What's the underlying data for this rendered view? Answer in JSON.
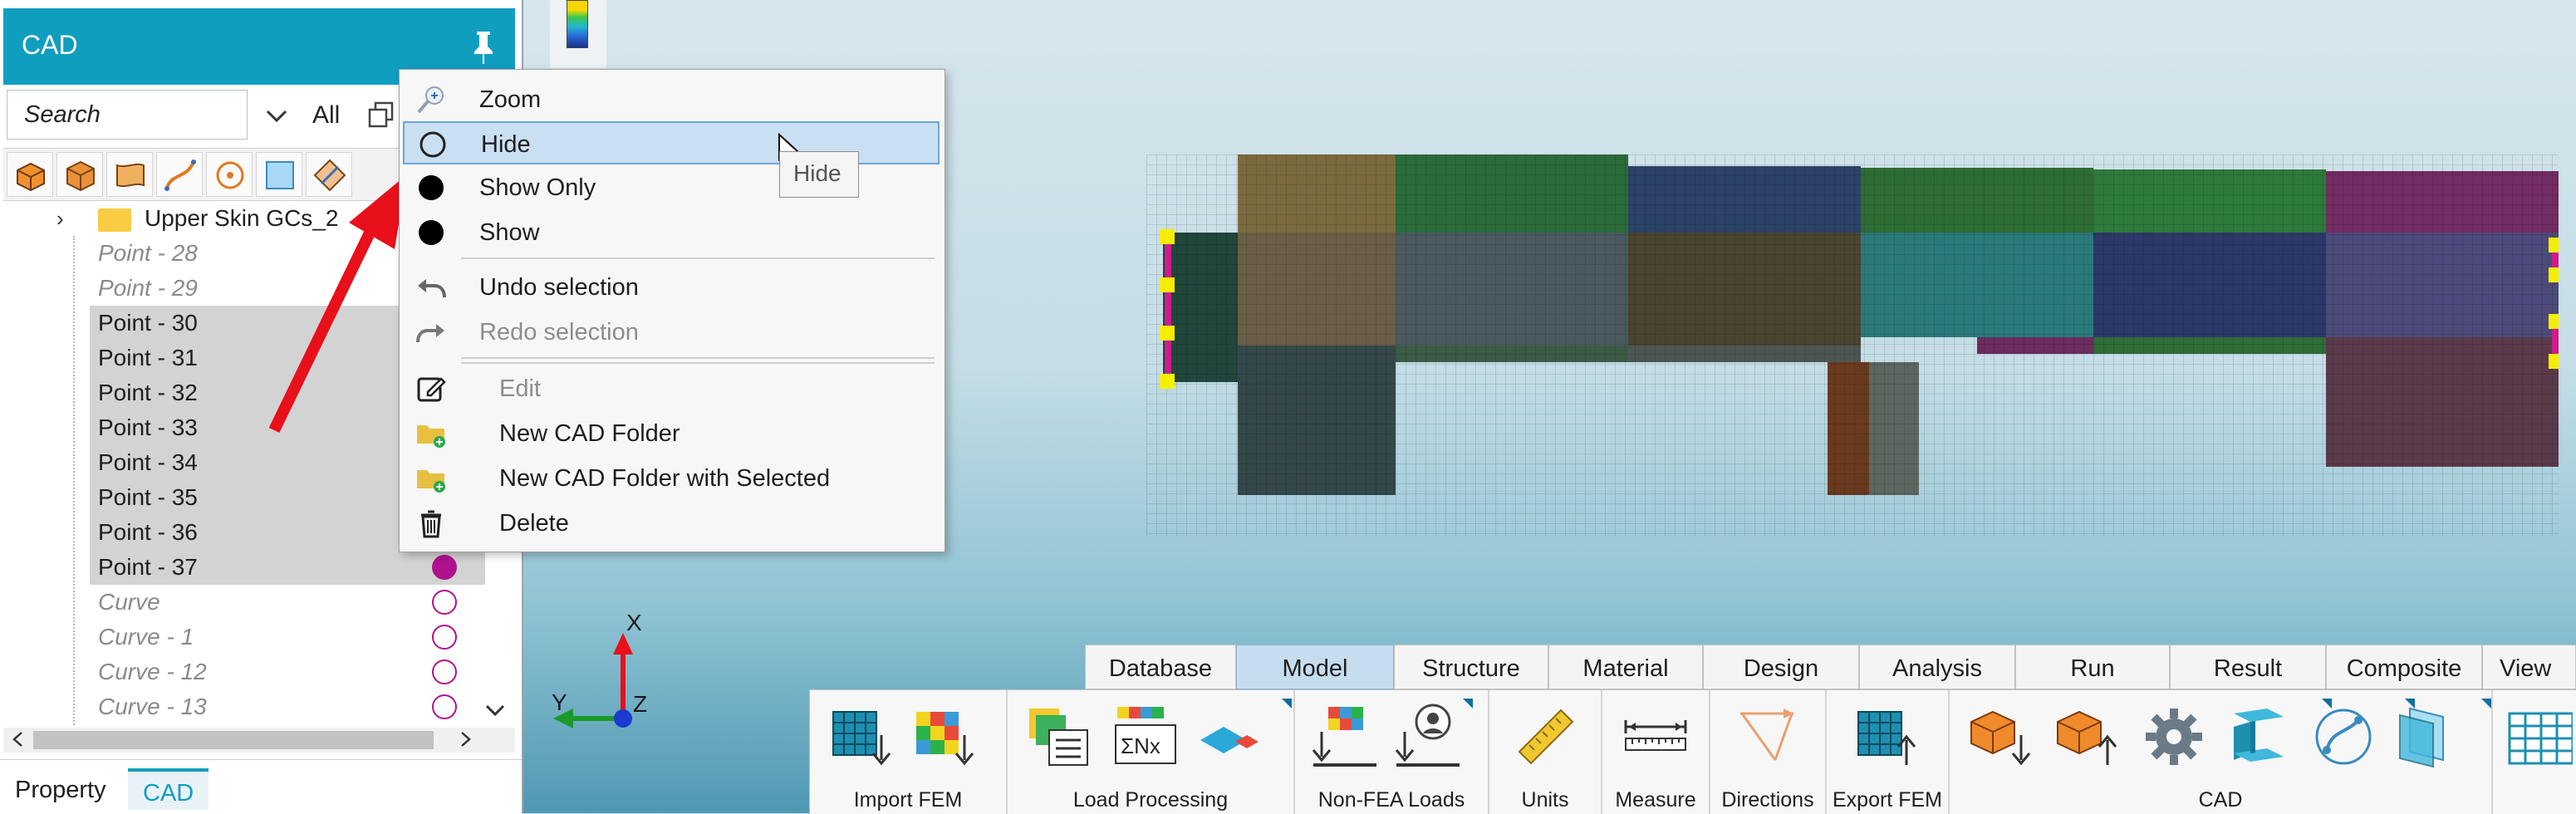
{
  "left_panel": {
    "header_title": "CAD",
    "search_placeholder": "Search",
    "filter_all": "All",
    "tree": {
      "folder": "Upper Skin GCs_2",
      "items": [
        {
          "label": "Point - 28",
          "style": "hidden"
        },
        {
          "label": "Point - 29",
          "style": "hidden"
        },
        {
          "label": "Point - 30",
          "style": "selected"
        },
        {
          "label": "Point - 31",
          "style": "selected"
        },
        {
          "label": "Point - 32",
          "style": "selected"
        },
        {
          "label": "Point - 33",
          "style": "selected"
        },
        {
          "label": "Point - 34",
          "style": "selected"
        },
        {
          "label": "Point - 35",
          "style": "selected"
        },
        {
          "label": "Point - 36",
          "style": "selected"
        },
        {
          "label": "Point - 37",
          "style": "selected"
        },
        {
          "label": "Curve",
          "style": "hidden"
        },
        {
          "label": "Curve - 1",
          "style": "hidden"
        },
        {
          "label": "Curve - 12",
          "style": "hidden"
        },
        {
          "label": "Curve - 13",
          "style": "hidden"
        }
      ]
    },
    "bottom_tabs": {
      "property": "Property",
      "cad": "CAD"
    }
  },
  "context_menu": {
    "zoom": "Zoom",
    "hide": "Hide",
    "show_only": "Show Only",
    "show": "Show",
    "undo": "Undo selection",
    "redo": "Redo selection",
    "edit": "Edit",
    "new_folder": "New CAD Folder",
    "new_folder_selected": "New CAD Folder with Selected",
    "delete": "Delete"
  },
  "tooltip": "Hide",
  "axis": {
    "x": "X",
    "y": "Y",
    "z": "Z"
  },
  "ribbon": {
    "tabs": [
      "Database",
      "Model",
      "Structure",
      "Material",
      "Design",
      "Analysis",
      "Run",
      "Result",
      "Composite",
      "View"
    ],
    "active_tab": "Model",
    "groups": {
      "import_fem": "Import FEM",
      "load_processing": "Load Processing",
      "non_fea_loads": "Non-FEA Loads",
      "units": "Units",
      "measure": "Measure",
      "directions": "Directions",
      "export_fem": "Export FEM",
      "cad": "CAD"
    }
  },
  "colors": {
    "accent": "#109ec0",
    "selection_dot": "#b0128e",
    "active_tab": "#c5ddee",
    "highlight_row": "#d3d3d3"
  },
  "icons": [
    "pin-icon",
    "chevron-down-icon",
    "copy-icon",
    "solid-icon",
    "box-icon",
    "surface-icon",
    "curve-icon",
    "point-icon",
    "plane-icon",
    "transform-icon",
    "zoom-icon",
    "circle-outline-icon",
    "circle-filled-icon",
    "undo-icon",
    "redo-icon",
    "edit-icon",
    "folder-add-icon",
    "trash-icon",
    "grid-icon",
    "gear-icon",
    "beam-icon"
  ]
}
